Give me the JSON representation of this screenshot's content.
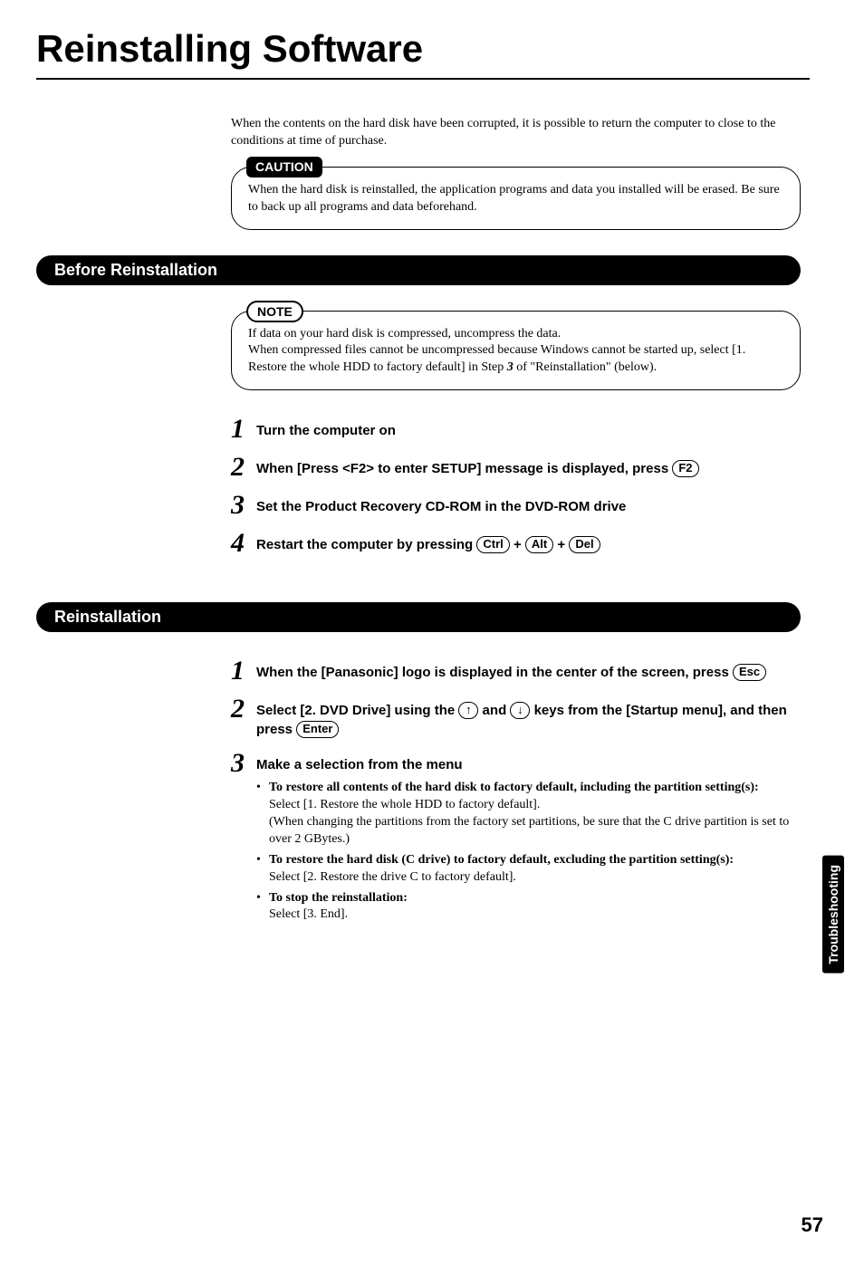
{
  "title": "Reinstalling Software",
  "intro": "When the contents on the hard disk have been corrupted, it is possible to return the computer to close to the conditions at time of purchase.",
  "caution": {
    "label": "CAUTION",
    "text": "When the hard disk is reinstalled, the application programs and data you installed will be erased. Be sure to back up all programs and data beforehand."
  },
  "sections": {
    "before": "Before Reinstallation",
    "reinstall": "Reinstallation"
  },
  "note": {
    "label": "NOTE",
    "line1": "If data on your hard disk is compressed, uncompress the data.",
    "line2_a": "When compressed files cannot be uncompressed because Windows cannot be started up, select [1. Restore the whole HDD to factory default] in Step ",
    "line2_step": "3",
    "line2_b": " of \"Reinstallation\" (below)."
  },
  "before_steps": {
    "s1": "Turn the computer on",
    "s2_a": "When [Press <F2> to enter SETUP] message is displayed, press ",
    "s2_key": "F2",
    "s3": "Set the Product Recovery CD-ROM in the DVD-ROM drive",
    "s4_a": "Restart the computer by pressing ",
    "s4_k1": "Ctrl",
    "s4_plus": " + ",
    "s4_k2": "Alt",
    "s4_k3": "Del"
  },
  "reinstall_steps": {
    "s1_a": "When the [Panasonic] logo is displayed in the center of the screen, press ",
    "s1_key": "Esc",
    "s2_a": "Select [2. DVD Drive] using the ",
    "s2_up": "↑",
    "s2_mid": " and ",
    "s2_down": "↓",
    "s2_b": " keys from the [Startup menu], and then press ",
    "s2_enter": "Enter",
    "s3_head": "Make a selection from the menu",
    "opt1_head": "To restore all contents of the hard disk to factory default, including the partition setting(s):",
    "opt1_body": "Select [1. Restore the whole HDD to factory default].\n(When changing the partitions from the factory set partitions, be sure that the C drive partition is set to over 2 GBytes.)",
    "opt2_head": "To restore the hard disk (C drive) to factory default, excluding the partition setting(s):",
    "opt2_body": "Select [2. Restore the drive C to factory default].",
    "opt3_head": "To stop the reinstallation:",
    "opt3_body": "Select [3. End]."
  },
  "tab": "Troubleshooting",
  "page_number": "57"
}
